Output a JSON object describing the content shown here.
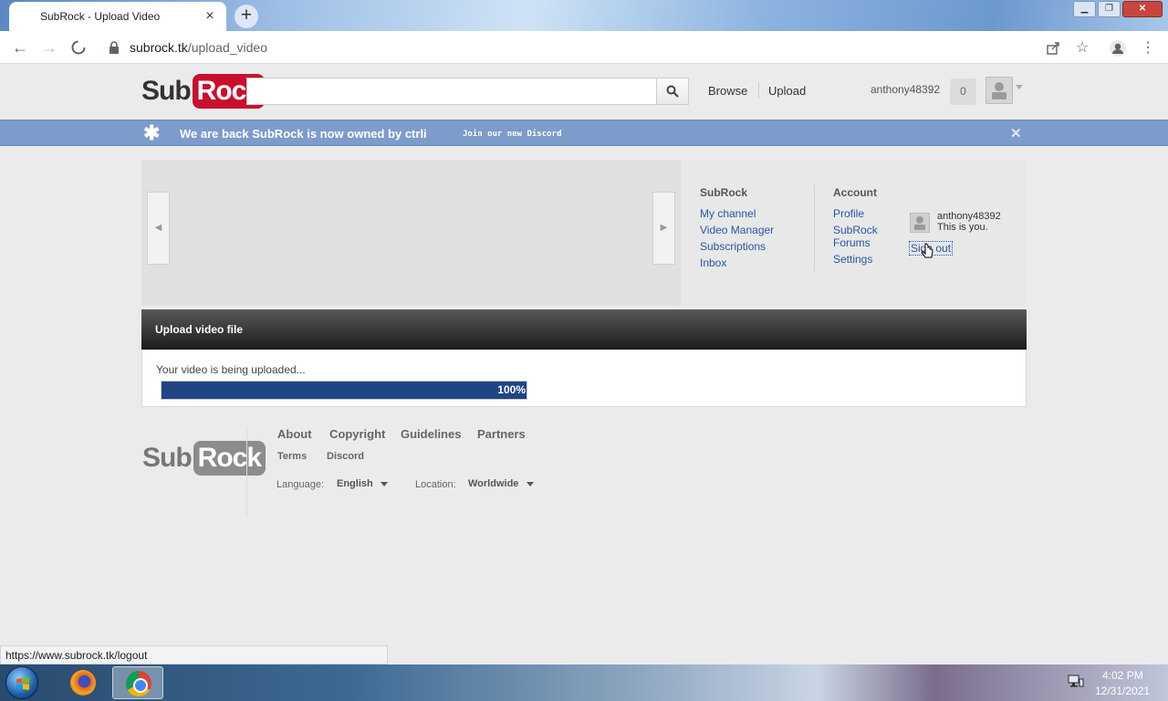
{
  "browser": {
    "tab_title": "SubRock - Upload Video",
    "tab_close": "×",
    "new_tab": "+",
    "url_host": "subrock.tk",
    "url_path": "/upload_video",
    "status_url": "https://www.subrock.tk/logout"
  },
  "header": {
    "logo_sub": "Sub",
    "logo_rock": "Rock",
    "search_placeholder": "",
    "nav_browse": "Browse",
    "nav_upload": "Upload",
    "username": "anthony48392",
    "notification_count": "0"
  },
  "notice": {
    "message": "We are back SubRock is now owned by ctrli",
    "discord_link": "Join our new Discord",
    "close": "✕"
  },
  "guide": {
    "subrock_heading": "SubRock",
    "subrock_links": [
      "My channel",
      "Video Manager",
      "Subscriptions",
      "Inbox"
    ],
    "account_heading": "Account",
    "account_links": [
      "Profile",
      "SubRock",
      "Forums",
      "Settings"
    ],
    "user_name": "anthony48392",
    "user_you": "This is you.",
    "sign_out": "Sign out"
  },
  "upload": {
    "heading": "Upload video file",
    "status": "Your video is being uploaded...",
    "progress_percent": 100,
    "progress_label": "100%"
  },
  "footer": {
    "logo_sub": "Sub",
    "logo_rock": "Rock",
    "links": [
      "About",
      "Copyright",
      "Guidelines",
      "Partners"
    ],
    "links2": [
      "Terms",
      "Discord"
    ],
    "language_label": "Language:",
    "language_value": "English",
    "location_label": "Location:",
    "location_value": "Worldwide"
  },
  "taskbar": {
    "time": "4:02 PM",
    "date": "12/31/2021"
  },
  "colors": {
    "brand_red": "#c8102e",
    "notice_blue": "#7d9ccb",
    "progress_blue": "#1f4585",
    "link_blue": "#2a55a8"
  },
  "icons": [
    "back-icon",
    "forward-icon",
    "stop-icon",
    "lock-icon",
    "share-icon",
    "star-icon",
    "profile-icon",
    "menu-icon",
    "search-icon",
    "asterisk-icon",
    "close-icon",
    "chevron-left-icon",
    "chevron-right-icon",
    "windows-start-icon",
    "firefox-icon",
    "chrome-icon",
    "network-icon"
  ]
}
